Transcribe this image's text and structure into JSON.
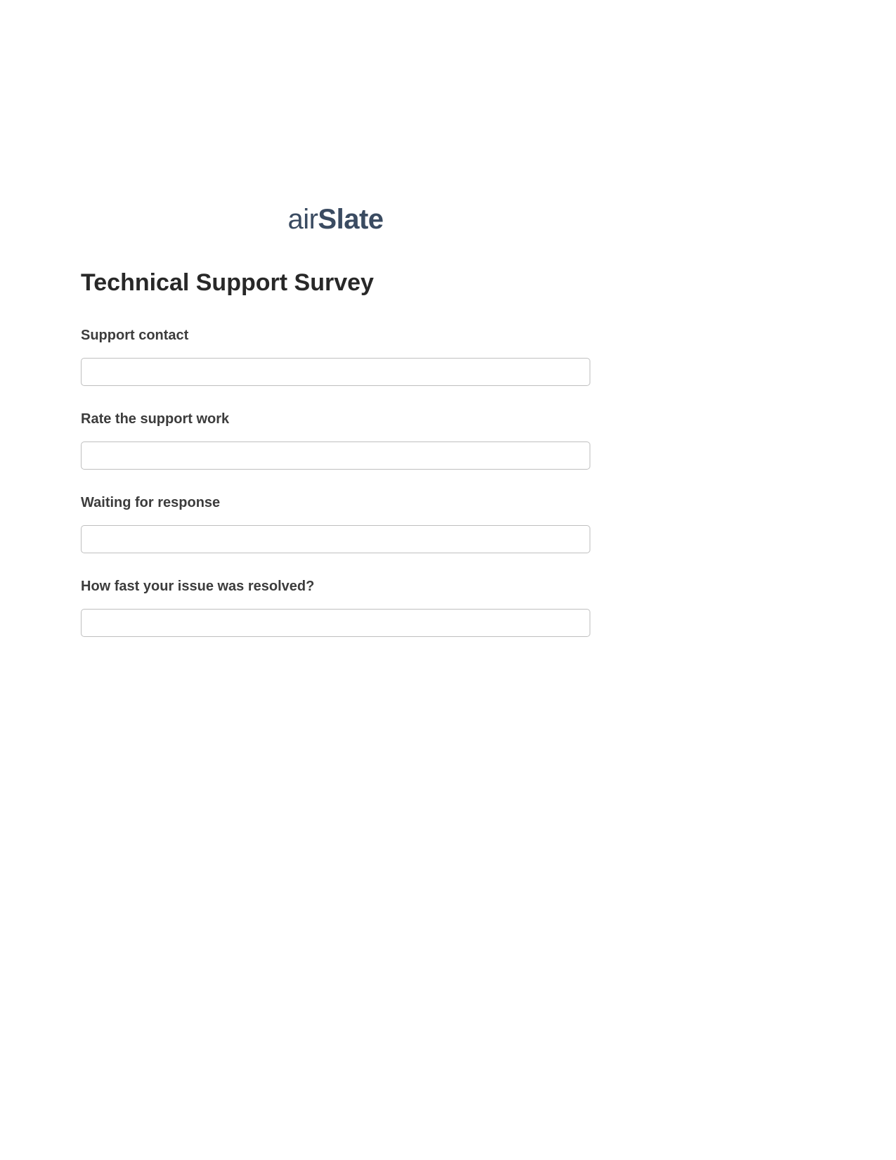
{
  "logo": {
    "part1": "air",
    "part2": "Slate"
  },
  "form": {
    "title": "Technical Support Survey",
    "fields": [
      {
        "label": "Support contact",
        "value": ""
      },
      {
        "label": "Rate the support work",
        "value": ""
      },
      {
        "label": "Waiting for response",
        "value": ""
      },
      {
        "label": "How fast your issue was resolved?",
        "value": ""
      }
    ]
  }
}
